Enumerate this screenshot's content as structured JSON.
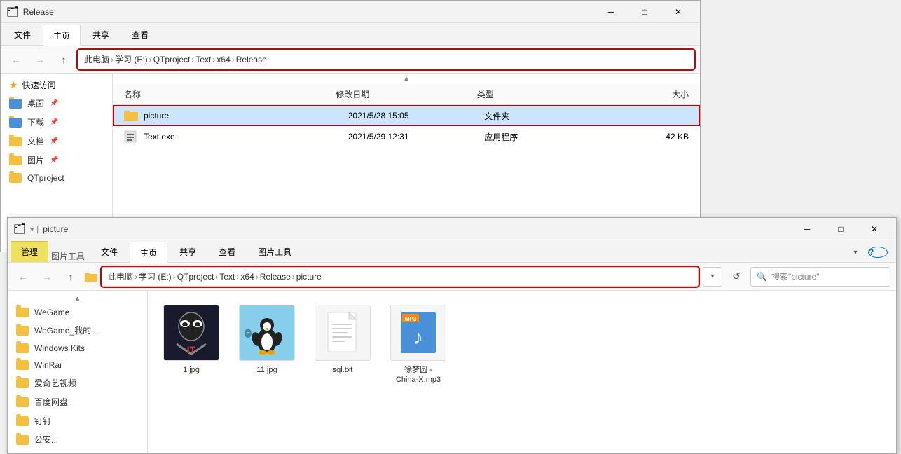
{
  "win1": {
    "titlebar": {
      "title": "Release",
      "icon": "📁"
    },
    "tabs": [
      "文件",
      "主页",
      "共享",
      "查看"
    ],
    "address": {
      "path": [
        "此电脑",
        "学习 (E:)",
        "QTproject",
        "Text",
        "x64",
        "Release"
      ],
      "outline": true
    },
    "columns": {
      "name": "名称",
      "date": "修改日期",
      "type": "类型",
      "size": "大小"
    },
    "files": [
      {
        "name": "picture",
        "date": "2021/5/28 15:05",
        "type": "文件夹",
        "size": "",
        "isFolder": true,
        "selected": true
      },
      {
        "name": "Text.exe",
        "date": "2021/5/29 12:31",
        "type": "应用程序",
        "size": "42 KB",
        "isFolder": false,
        "selected": false
      }
    ],
    "sidebar": {
      "quickaccess_label": "快速访问",
      "items": [
        {
          "label": "桌面",
          "pinned": true
        },
        {
          "label": "下载",
          "pinned": true
        },
        {
          "label": "文档",
          "pinned": true
        },
        {
          "label": "图片",
          "pinned": true
        },
        {
          "label": "QTproject",
          "pinned": false
        }
      ]
    }
  },
  "win2": {
    "titlebar": {
      "title": "picture",
      "icon": "📁"
    },
    "tabs": {
      "manage_label": "管理",
      "regular": [
        "文件",
        "主页",
        "共享",
        "查看"
      ],
      "context": [
        "图片工具"
      ]
    },
    "address": {
      "path": [
        "此电脑",
        "学习 (E:)",
        "QTproject",
        "Text",
        "x64",
        "Release",
        "picture"
      ],
      "outline": true
    },
    "search_placeholder": "搜索\"picture\"",
    "sidebar_items": [
      {
        "label": "WeGame"
      },
      {
        "label": "WeGame_我的..."
      },
      {
        "label": "Windows Kits"
      },
      {
        "label": "WinRar"
      },
      {
        "label": "爱奇艺视频"
      },
      {
        "label": "百度网盘"
      },
      {
        "label": "钉钉"
      },
      {
        "label": "公安..."
      }
    ],
    "files": [
      {
        "name": "1.jpg",
        "thumb_type": "jpg_it",
        "label": "1.jpg"
      },
      {
        "name": "11.jpg",
        "thumb_type": "jpg_penguin",
        "label": "11.jpg"
      },
      {
        "name": "sql.txt",
        "thumb_type": "txt",
        "label": "sql.txt"
      },
      {
        "name": "徐梦圆 - China-X.mp3",
        "thumb_type": "mp3",
        "label": "徐梦圆 -\nChina-X.mp3"
      }
    ]
  },
  "icons": {
    "back": "←",
    "forward": "→",
    "up": "↑",
    "dropdown": "▾",
    "refresh": "↺",
    "search": "🔍",
    "close": "✕",
    "minimize": "─",
    "maximize": "□",
    "help": "?",
    "chevron_down": "›",
    "separator": "›"
  }
}
